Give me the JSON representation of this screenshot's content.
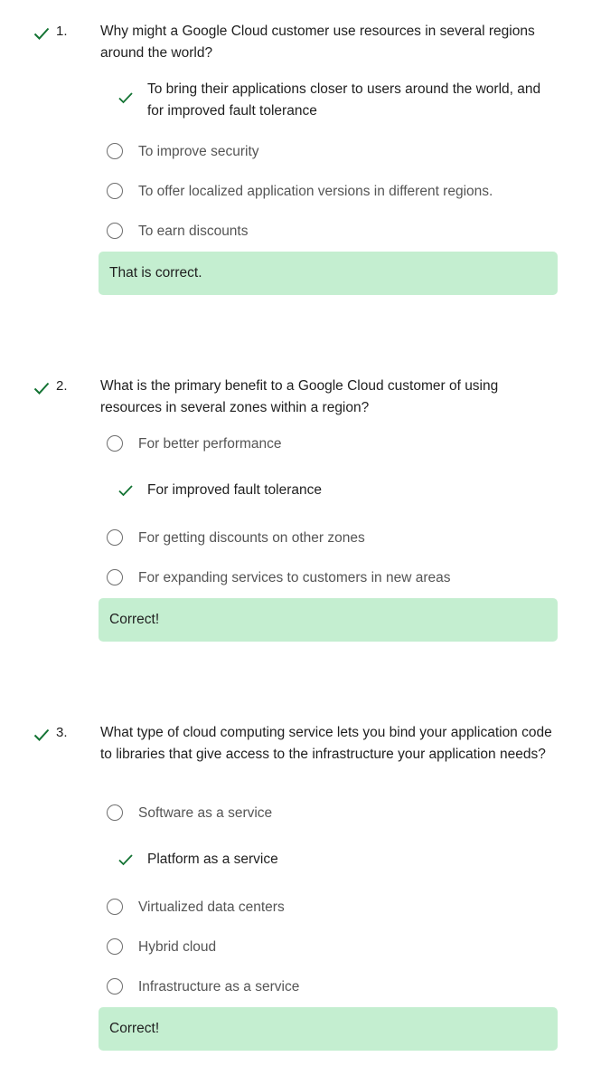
{
  "colors": {
    "correct_green": "#137333",
    "feedback_bg": "#c4eed0"
  },
  "questions": [
    {
      "number": "1.",
      "status_icon": "checkmark-icon",
      "text": "Why might a Google Cloud customer use resources in several regions around the world?",
      "selected_option": "To bring their applications closer to users around the world, and for improved fault tolerance",
      "options": [
        "To improve security",
        "To offer localized application versions in different regions.",
        "To earn discounts"
      ],
      "feedback": "That is correct."
    },
    {
      "number": "2.",
      "status_icon": "checkmark-icon",
      "text": "What is the primary benefit to a Google Cloud customer of using resources in several zones within a region?",
      "options_before": [
        "For better performance"
      ],
      "selected_option": "For improved fault tolerance",
      "options_after": [
        "For getting discounts on other zones",
        "For expanding services to customers in new areas"
      ],
      "feedback": "Correct!"
    },
    {
      "number": "3.",
      "status_icon": "checkmark-icon",
      "text": "What type of cloud computing service lets you bind your application code to libraries that give access to the infrastructure your application needs?",
      "options_before": [
        "Software as a service"
      ],
      "selected_option": "Platform as a service",
      "options_after": [
        "Virtualized data centers",
        "Hybrid cloud",
        "Infrastructure as a service"
      ],
      "feedback": "Correct!"
    }
  ]
}
